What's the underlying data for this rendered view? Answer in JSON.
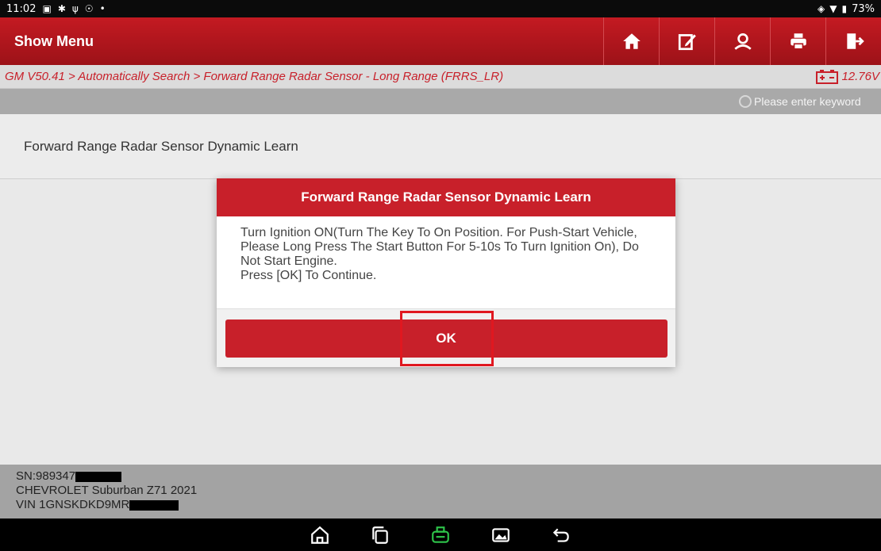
{
  "status_bar": {
    "time": "11:02",
    "battery": "73%"
  },
  "header": {
    "title": "Show Menu"
  },
  "toolbar": {
    "buttons": [
      {
        "icon": "home-icon"
      },
      {
        "icon": "edit-icon"
      },
      {
        "icon": "account-icon"
      },
      {
        "icon": "print-icon"
      },
      {
        "icon": "exit-icon"
      }
    ]
  },
  "breadcrumb": {
    "path": "GM V50.41 > Automatically Search > Forward Range Radar Sensor - Long Range (FRRS_LR)",
    "voltage": "12.76V"
  },
  "search": {
    "placeholder": "Please enter keyword"
  },
  "content": {
    "items": [
      {
        "label": "Forward Range Radar Sensor Dynamic Learn"
      }
    ]
  },
  "dialog": {
    "title": "Forward Range Radar Sensor Dynamic Learn",
    "message": "Turn Ignition ON(Turn The Key To On Position. For Push-Start Vehicle, Please Long Press The Start Button For 5-10s To Turn Ignition On), Do Not Start Engine.",
    "prompt": "Press [OK] To Continue.",
    "ok_label": "OK"
  },
  "vehicle_info": {
    "sn": "SN:989347",
    "model": "CHEVROLET Suburban Z71 2021",
    "vin": "VIN 1GNSKDKD9MR"
  },
  "colors": {
    "brand_red": "#c8202a",
    "header_red": "#b0141c"
  }
}
